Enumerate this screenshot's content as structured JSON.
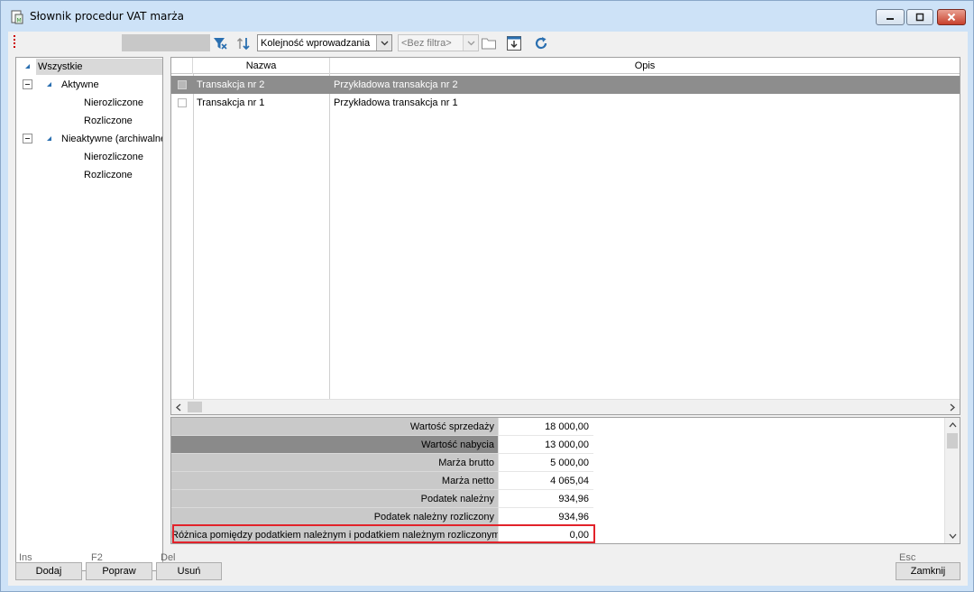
{
  "window": {
    "title": "Słownik procedur VAT marża"
  },
  "toolbar": {
    "sort_combo_value": "Kolejność wprowadzania",
    "filter_combo_value": "<Bez filtra>"
  },
  "tree": {
    "items": [
      {
        "label": "Wszystkie"
      },
      {
        "label": "Aktywne"
      },
      {
        "label": "Nierozliczone"
      },
      {
        "label": "Rozliczone"
      },
      {
        "label": "Nieaktywne (archiwalne"
      },
      {
        "label": "Nierozliczone"
      },
      {
        "label": "Rozliczone"
      }
    ]
  },
  "grid": {
    "columns": [
      "Nazwa",
      "Opis"
    ],
    "rows": [
      {
        "nazwa": "Transakcja nr 2",
        "opis": "Przykładowa transakcja nr 2"
      },
      {
        "nazwa": "Transakcja nr 1",
        "opis": "Przykładowa transakcja nr 1"
      }
    ]
  },
  "summary": {
    "rows": [
      {
        "label": "Wartość sprzedaży",
        "value": "18 000,00"
      },
      {
        "label": "Wartość nabycia",
        "value": "13 000,00"
      },
      {
        "label": "Marża brutto",
        "value": "5 000,00"
      },
      {
        "label": "Marża netto",
        "value": "4 065,04"
      },
      {
        "label": "Podatek należny",
        "value": "934,96"
      },
      {
        "label": "Podatek należny rozliczony",
        "value": "934,96"
      },
      {
        "label": "Różnica pomiędzy podatkiem należnym i podatkiem należnym rozliczonym",
        "value": "0,00"
      }
    ]
  },
  "buttons": {
    "add": {
      "label": "Dodaj",
      "key": "Ins"
    },
    "edit": {
      "label": "Popraw",
      "key": "F2"
    },
    "delete": {
      "label": "Usuń",
      "key": "Del"
    },
    "close": {
      "label": "Zamknij",
      "key": "Esc"
    }
  },
  "colors": {
    "titlebar": "#cde2f7",
    "selection": "#8d8d8d",
    "highlight": "#e2222a",
    "accent_icon": "#2a6fb0"
  }
}
